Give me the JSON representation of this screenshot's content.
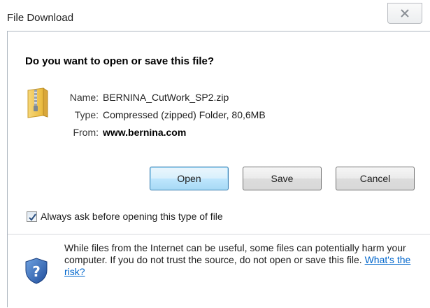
{
  "window": {
    "title": "File Download",
    "close_icon": "close-icon"
  },
  "dialog": {
    "question": "Do you want to open or save this file?",
    "file_icon": "zip-folder-icon",
    "name_label": "Name:",
    "name_value": "BERNINA_CutWork_SP2.zip",
    "type_label": "Type:",
    "type_value": "Compressed (zipped) Folder, 80,6MB",
    "from_label": "From:",
    "from_value": "www.bernina.com"
  },
  "buttons": {
    "open": "Open",
    "save": "Save",
    "cancel": "Cancel"
  },
  "checkbox": {
    "label": "Always ask before opening this type of file",
    "checked": true
  },
  "warning": {
    "icon": "shield-question-icon",
    "text": "While files from the Internet can be useful, some files can potentially harm your computer. If you do not trust the source, do not open or save this file.",
    "link": "What's the risk?",
    "link_color": "#0066cc"
  }
}
